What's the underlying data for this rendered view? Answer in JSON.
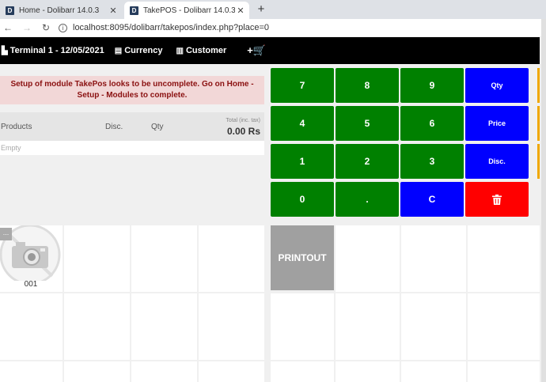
{
  "browser": {
    "tabs": [
      {
        "title": "Home - Dolibarr 14.0.3",
        "favicon": "D"
      },
      {
        "title": "TakePOS - Dolibarr 14.0.3",
        "favicon": "D"
      }
    ],
    "close_glyph": "✕",
    "new_tab_glyph": "+",
    "url": "localhost:8095/dolibarr/takepos/index.php?place=0"
  },
  "header": {
    "terminal": "Terminal 1 - 12/05/2021",
    "currency": "Currency",
    "customer": "Customer",
    "add_glyph": "+🛒"
  },
  "warning": "Setup of module TakePos looks to be uncomplete. Go on Home - Setup - Modules to complete.",
  "order": {
    "col_products": "Products",
    "col_disc": "Disc.",
    "col_qty": "Qty",
    "total_label": "Total (inc. tax)",
    "total_value": "0.00 Rs",
    "empty": "Empty"
  },
  "keypad": {
    "k7": "7",
    "k8": "8",
    "k9": "9",
    "qty": "Qty",
    "k4": "4",
    "k5": "5",
    "k6": "6",
    "price": "Price",
    "k1": "1",
    "k2": "2",
    "k3": "3",
    "disc": "Disc.",
    "k0": "0",
    "dot": ".",
    "clear": "C"
  },
  "products": {
    "more": "...",
    "item_label": "001",
    "printout": "PRINTOUT"
  },
  "colors": {
    "keypad_number": "#008000",
    "keypad_action": "#0000ff",
    "keypad_delete": "#ff0000",
    "warning_bg": "#f2d7d7",
    "header_bg": "#000000"
  }
}
